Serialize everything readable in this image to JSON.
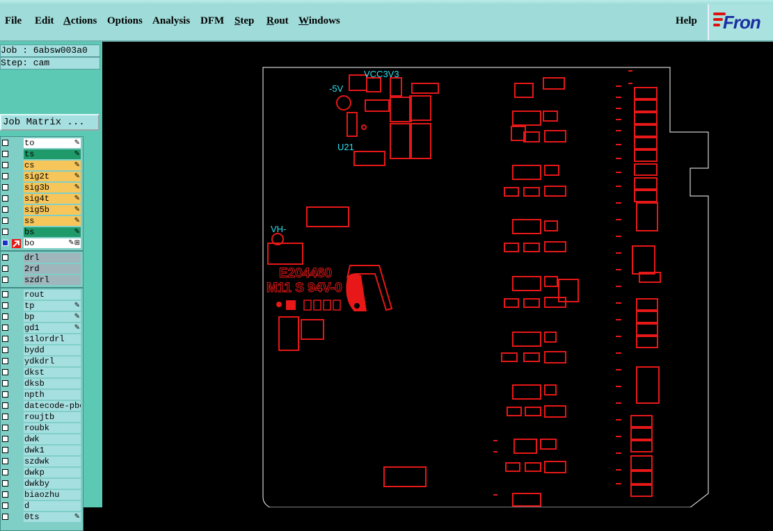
{
  "menubar": {
    "items": [
      "File",
      "Edit",
      "Actions",
      "Options",
      "Analysis",
      "DFM",
      "Step",
      "Rout",
      "Windows"
    ],
    "help": "Help",
    "logo": "Fron"
  },
  "job": {
    "job_label": "Job : 6absw003a0",
    "step_label": "Step: cam",
    "matrix_button": "Job Matrix ..."
  },
  "layers": [
    {
      "name": "to",
      "color": "#ffffff",
      "mark": "✎"
    },
    {
      "name": "ts",
      "color": "#1f9a6a",
      "mark": "✎"
    },
    {
      "name": "cs",
      "color": "#f7c65a",
      "mark": "✎"
    },
    {
      "name": "sig2t",
      "color": "#f7c65a",
      "mark": "✎"
    },
    {
      "name": "sig3b",
      "color": "#f7c65a",
      "mark": "✎"
    },
    {
      "name": "sig4t",
      "color": "#f7c65a",
      "mark": "✎"
    },
    {
      "name": "sig5b",
      "color": "#f7c65a",
      "mark": "✎"
    },
    {
      "name": "ss",
      "color": "#f7c65a",
      "mark": "✎"
    },
    {
      "name": "bs",
      "color": "#1f9a6a",
      "mark": "✎"
    },
    {
      "name": "bo",
      "color": "#ffffff",
      "mark": "✎⊞",
      "active": true
    },
    {
      "name": "drl",
      "color": "#9fb6bd",
      "mark": ""
    },
    {
      "name": "2rd",
      "color": "#9fb6bd",
      "mark": ""
    },
    {
      "name": "szdrl",
      "color": "#9fb6bd",
      "mark": ""
    },
    {
      "name": "rout",
      "color": "#a6dfe0",
      "mark": ""
    },
    {
      "name": "tp",
      "color": "#a6dfe0",
      "mark": "✎"
    },
    {
      "name": "bp",
      "color": "#a6dfe0",
      "mark": "✎"
    },
    {
      "name": "gd1",
      "color": "#a6dfe0",
      "mark": "✎"
    },
    {
      "name": "s1lordrl",
      "color": "#a6dfe0",
      "mark": ""
    },
    {
      "name": "bydd",
      "color": "#a6dfe0",
      "mark": ""
    },
    {
      "name": "ydkdrl",
      "color": "#a6dfe0",
      "mark": ""
    },
    {
      "name": "dkst",
      "color": "#a6dfe0",
      "mark": ""
    },
    {
      "name": "dksb",
      "color": "#a6dfe0",
      "mark": ""
    },
    {
      "name": "npth",
      "color": "#a6dfe0",
      "mark": ""
    },
    {
      "name": "datecode-pbc",
      "color": "#a6dfe0",
      "mark": ""
    },
    {
      "name": "roujtb",
      "color": "#a6dfe0",
      "mark": ""
    },
    {
      "name": "roubk",
      "color": "#a6dfe0",
      "mark": ""
    },
    {
      "name": "dwk",
      "color": "#a6dfe0",
      "mark": ""
    },
    {
      "name": "dwk1",
      "color": "#a6dfe0",
      "mark": ""
    },
    {
      "name": "szdwk",
      "color": "#a6dfe0",
      "mark": ""
    },
    {
      "name": "dwkp",
      "color": "#a6dfe0",
      "mark": ""
    },
    {
      "name": "dwkby",
      "color": "#a6dfe0",
      "mark": ""
    },
    {
      "name": "biaozhu",
      "color": "#a6dfe0",
      "mark": ""
    },
    {
      "name": "d",
      "color": "#a6dfe0",
      "mark": ""
    },
    {
      "name": "0ts",
      "color": "#a6dfe0",
      "mark": "✎"
    }
  ],
  "canvas": {
    "silk_labels": {
      "vcc": "VCC3V3",
      "neg5v": "-5V",
      "u21": "U21",
      "vh": "VH-",
      "code1": "E204460",
      "code2": "M11 S 94V-0"
    },
    "trace_color": "#e81818",
    "silk_color": "#2fe0ee"
  }
}
